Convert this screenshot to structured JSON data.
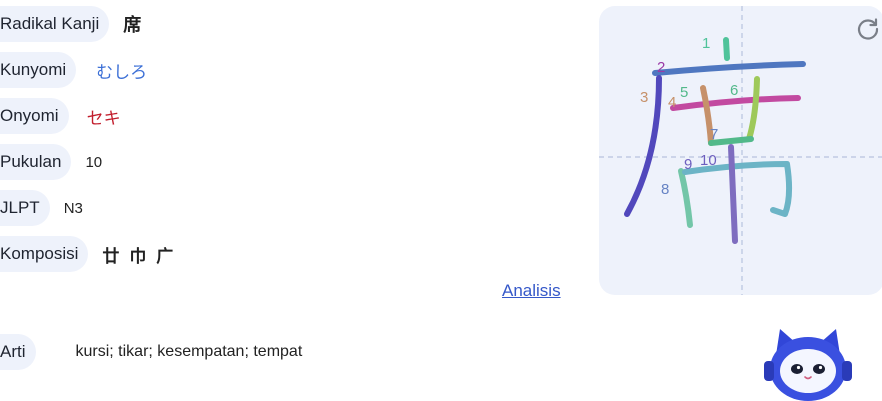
{
  "info": {
    "radical_label": "Radikal Kanji",
    "radical_value": "席",
    "kunyomi_label": "Kunyomi",
    "kunyomi_value": "むしろ",
    "onyomi_label": "Onyomi",
    "onyomi_value": "セキ",
    "strokes_label": "Pukulan",
    "strokes_value": "10",
    "jlpt_label": "JLPT",
    "jlpt_value": "N3",
    "composition_label": "Komposisi",
    "composition_value": "廿 巾 广"
  },
  "analysis_link": "Analisis",
  "meaning": {
    "label": "Arti",
    "value": "kursi; tikar; kesempatan; tempat"
  },
  "stroke_panel": {
    "numbers": [
      "1",
      "2",
      "3",
      "4",
      "5",
      "6",
      "7",
      "8",
      "9",
      "10"
    ],
    "refresh_icon": "refresh-icon"
  },
  "mascot_icon": "robot-cat-mascot-icon",
  "colors": {
    "label_bg": "#eef2fb",
    "kunyomi": "#3b6fd6",
    "onyomi": "#c21d2c",
    "link": "#3558c9"
  }
}
